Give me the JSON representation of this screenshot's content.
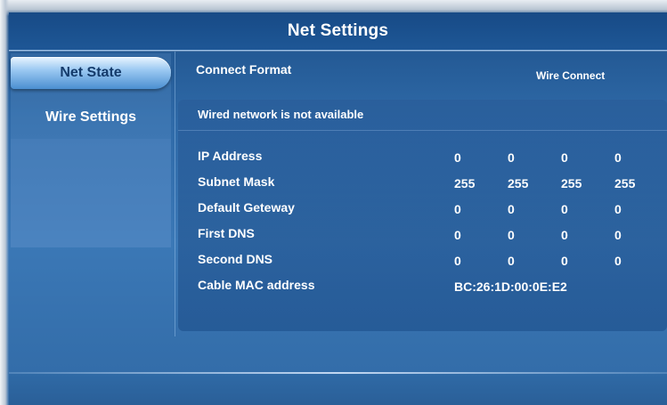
{
  "header": {
    "title": "Net Settings"
  },
  "sidebar": {
    "items": [
      {
        "label": "Net State",
        "active": true
      },
      {
        "label": "Wire Settings",
        "active": false
      }
    ]
  },
  "connect": {
    "label": "Connect Format",
    "value": "Wire Connect"
  },
  "status": {
    "text": "Wired network is not available"
  },
  "rows": [
    {
      "label": "IP Address",
      "values": [
        "0",
        "0",
        "0",
        "0"
      ]
    },
    {
      "label": "Subnet Mask",
      "values": [
        "255",
        "255",
        "255",
        "255"
      ]
    },
    {
      "label": "Default Geteway",
      "values": [
        "0",
        "0",
        "0",
        "0"
      ]
    },
    {
      "label": "First DNS",
      "values": [
        "0",
        "0",
        "0",
        "0"
      ]
    },
    {
      "label": "Second DNS",
      "values": [
        "0",
        "0",
        "0",
        "0"
      ]
    }
  ],
  "mac": {
    "label": "Cable MAC address",
    "value": "BC:26:1D:00:0E:E2"
  },
  "colors": {
    "background": "#2f6aa8",
    "title_bar": "#1e5796",
    "selected_tab": "#9cc9f2",
    "text": "#ffffff"
  }
}
